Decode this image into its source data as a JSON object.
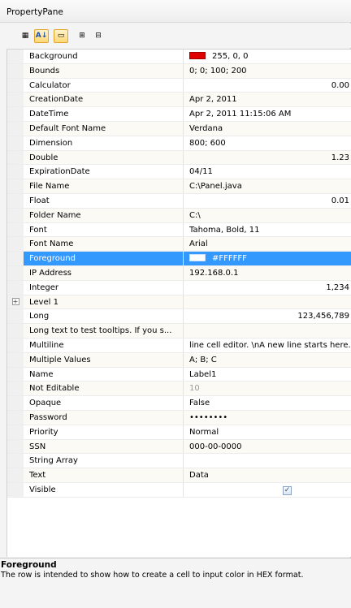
{
  "window": {
    "title": "PropertyPane"
  },
  "toolbar": {
    "buttons": [
      {
        "name": "categorized-button",
        "glyph": "▦"
      },
      {
        "name": "sort-alphabetical-button",
        "glyph": "A↓"
      },
      {
        "name": "property-pages-button",
        "glyph": "▭"
      },
      {
        "name": "expand-all-button",
        "glyph": "⊞"
      },
      {
        "name": "collapse-all-button",
        "glyph": "⊟"
      }
    ]
  },
  "properties": [
    {
      "name": "Background",
      "value": "255, 0, 0",
      "swatch": "red"
    },
    {
      "name": "Bounds",
      "value": "0; 0; 100; 200"
    },
    {
      "name": "Calculator",
      "value": "0.00",
      "align": "right"
    },
    {
      "name": "CreationDate",
      "value": "Apr 2, 2011"
    },
    {
      "name": "DateTime",
      "value": "Apr 2, 2011 11:15:06 AM"
    },
    {
      "name": "Default Font Name",
      "value": "Verdana"
    },
    {
      "name": "Dimension",
      "value": "800; 600"
    },
    {
      "name": "Double",
      "value": "1.23",
      "align": "right"
    },
    {
      "name": "ExpirationDate",
      "value": "04/11"
    },
    {
      "name": "File Name",
      "value": "C:\\Panel.java"
    },
    {
      "name": "Float",
      "value": "0.01",
      "align": "right"
    },
    {
      "name": "Folder Name",
      "value": "C:\\"
    },
    {
      "name": "Font",
      "value": "Tahoma, Bold, 11"
    },
    {
      "name": "Font Name",
      "value": "Arial"
    },
    {
      "name": "Foreground",
      "value": "#FFFFFF",
      "swatch": "white",
      "selected": true
    },
    {
      "name": "IP Address",
      "value": "192.168.0.1"
    },
    {
      "name": "Integer",
      "value": "1,234",
      "align": "right"
    },
    {
      "name": "Level 1",
      "value": "",
      "expandable": true
    },
    {
      "name": "Long",
      "value": "123,456,789",
      "align": "right"
    },
    {
      "name": "Long text to test tooltips. If you s...",
      "value": ""
    },
    {
      "name": "Multiline",
      "value": "line cell editor. \\nA new line starts here."
    },
    {
      "name": "Multiple Values",
      "value": "A; B; C"
    },
    {
      "name": "Name",
      "value": "Label1"
    },
    {
      "name": "Not Editable",
      "value": "10",
      "disabled": true
    },
    {
      "name": "Opaque",
      "value": "False"
    },
    {
      "name": "Password",
      "value": "••••••••"
    },
    {
      "name": "Priority",
      "value": "Normal"
    },
    {
      "name": "SSN",
      "value": "000-00-0000"
    },
    {
      "name": "String Array",
      "value": ""
    },
    {
      "name": "Text",
      "value": "Data"
    },
    {
      "name": "Visible",
      "value": "",
      "checkbox": true,
      "checked": true
    }
  ],
  "description": {
    "title": "Foreground",
    "text": "The row is intended to show how to create a cell to input color in HEX format."
  },
  "colors": {
    "selection": "#3399ff",
    "background_swatch": "#e00000",
    "active_button": "#ffd877"
  }
}
